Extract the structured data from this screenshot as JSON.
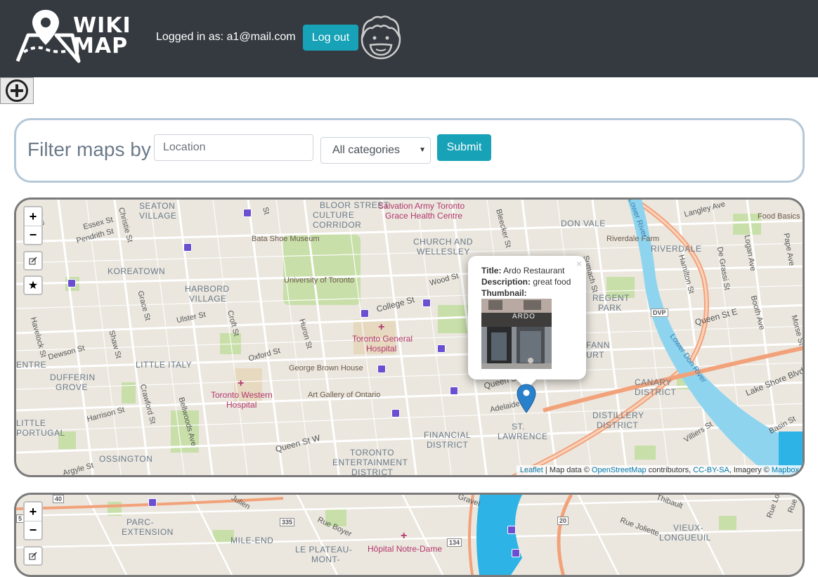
{
  "header": {
    "logo_text": "WIKI\nMAP",
    "login_prefix": "Logged in as: a1@mail.com",
    "logout_label": "Log out"
  },
  "toolbar": {
    "add_icon": "plus-circle-icon"
  },
  "filter": {
    "label": "Filter maps by",
    "location_placeholder": "Location",
    "category_selected": "All categories",
    "submit_label": "Submit"
  },
  "map1": {
    "zoom_in": "+",
    "zoom_out": "−",
    "edit_icon": "edit-icon",
    "star_icon": "★",
    "popup": {
      "title_label": "Title:",
      "title_value": "Ardo Restaurant",
      "description_label": "Description:",
      "description_value": "great food",
      "thumbnail_label": "Thumbnail:",
      "close": "×",
      "storefront_text": "ARDO"
    },
    "attribution": {
      "leaflet": "Leaflet",
      "sep1": " | Map data © ",
      "osm": "OpenStreetMap",
      "sep2": " contributors, ",
      "license": "CC-BY-SA",
      "sep3": ", Imagery © ",
      "mapbox": "Mapbox"
    },
    "labels": [
      {
        "text": "SEATON",
        "cls": "dist"
      },
      {
        "text": "VILLAGE",
        "cls": "dist"
      },
      {
        "text": "BLOOR STREET",
        "cls": "dist"
      },
      {
        "text": "CULTURE",
        "cls": "dist"
      },
      {
        "text": "CORRIDOR",
        "cls": "dist"
      },
      {
        "text": "Salvation Army Toronto",
        "cls": "hosp"
      },
      {
        "text": "Grace Health Centre",
        "cls": "hosp"
      },
      {
        "text": "DON VALE",
        "cls": "dist"
      },
      {
        "text": "Food Basics",
        "cls": "poi"
      },
      {
        "text": "Essex St",
        "cls": "st"
      },
      {
        "text": "Pendrith St",
        "cls": "st"
      },
      {
        "text": "Christie St",
        "cls": "st"
      },
      {
        "text": "Bata Shoe Museum",
        "cls": "poi"
      },
      {
        "text": "CHURCH AND",
        "cls": "dist"
      },
      {
        "text": "WELLESLEY",
        "cls": "dist"
      },
      {
        "text": "Riverdale Farm",
        "cls": "poi"
      },
      {
        "text": "RIVERDALE",
        "cls": "dist"
      },
      {
        "text": "KOREATOWN",
        "cls": "dist"
      },
      {
        "text": "University of Toronto",
        "cls": "poi"
      },
      {
        "text": "HARBORD",
        "cls": "dist"
      },
      {
        "text": "VILLAGE",
        "cls": "dist"
      },
      {
        "text": "Wood St",
        "cls": "st"
      },
      {
        "text": "REGENT",
        "cls": "dist"
      },
      {
        "text": "PARK",
        "cls": "dist"
      },
      {
        "text": "College St",
        "cls": "st"
      },
      {
        "text": "Ulster St",
        "cls": "st"
      },
      {
        "text": "Queen St E",
        "cls": "st"
      },
      {
        "text": "Toronto General",
        "cls": "hosp"
      },
      {
        "text": "Hospital",
        "cls": "hosp"
      },
      {
        "text": "Dewson St",
        "cls": "st"
      },
      {
        "text": "Oxford St",
        "cls": "st"
      },
      {
        "text": "LITTLE ITALY",
        "cls": "dist"
      },
      {
        "text": "George Brown House",
        "cls": "poi"
      },
      {
        "text": "DUFFERIN",
        "cls": "dist"
      },
      {
        "text": "GROVE",
        "cls": "dist"
      },
      {
        "text": "Toronto Western",
        "cls": "hosp"
      },
      {
        "text": "Hospital",
        "cls": "hosp"
      },
      {
        "text": "Art Gallery of Ontario",
        "cls": "poi"
      },
      {
        "text": "Queen St",
        "cls": "st"
      },
      {
        "text": "CANARY",
        "cls": "dist"
      },
      {
        "text": "DISTRICT",
        "cls": "dist"
      },
      {
        "text": "Lake Shore Blvd E",
        "cls": "st"
      },
      {
        "text": "Harrison St",
        "cls": "st"
      },
      {
        "text": "Adelaide",
        "cls": "st"
      },
      {
        "text": "ST.",
        "cls": "dist"
      },
      {
        "text": "LAWRENCE",
        "cls": "dist"
      },
      {
        "text": "DISTILLERY",
        "cls": "dist"
      },
      {
        "text": "DISTRICT",
        "cls": "dist"
      },
      {
        "text": "LITTLE",
        "cls": "dist"
      },
      {
        "text": "PORTUGAL",
        "cls": "dist"
      },
      {
        "text": "FINANCIAL",
        "cls": "dist"
      },
      {
        "text": "DISTRICT",
        "cls": "dist"
      },
      {
        "text": "Villiers St",
        "cls": "st"
      },
      {
        "text": "Basin St",
        "cls": "st"
      },
      {
        "text": "OSSINGTON",
        "cls": "dist"
      },
      {
        "text": "Queen St W",
        "cls": "st"
      },
      {
        "text": "TORONTO",
        "cls": "dist"
      },
      {
        "text": "ENTERTAINMENT",
        "cls": "dist"
      },
      {
        "text": "DISTRICT",
        "cls": "dist"
      },
      {
        "text": "Argyle St",
        "cls": "st"
      },
      {
        "text": "DVP",
        "cls": "st"
      },
      {
        "text": "Logan Ave",
        "cls": "st"
      },
      {
        "text": "Pape Ave",
        "cls": "st"
      },
      {
        "text": "Langley Ave",
        "cls": "st"
      },
      {
        "text": "Hamilton St",
        "cls": "st"
      },
      {
        "text": "De Grassi St",
        "cls": "st"
      },
      {
        "text": "Booth Ave",
        "cls": "st"
      },
      {
        "text": "Morse St",
        "cls": "st"
      },
      {
        "text": "Lower Don River",
        "cls": "st"
      },
      {
        "text": "Grace St",
        "cls": "st"
      },
      {
        "text": "Havelock St",
        "cls": "st"
      },
      {
        "text": "Shaw St",
        "cls": "st"
      },
      {
        "text": "Crawford St",
        "cls": "st"
      },
      {
        "text": "Bellwoods Ave",
        "cls": "st"
      },
      {
        "text": "Croft St",
        "cls": "st"
      },
      {
        "text": "Huron St",
        "cls": "st"
      },
      {
        "text": "Bleecker St",
        "cls": "st"
      },
      {
        "text": "Sumach St",
        "cls": "st"
      },
      {
        "text": "Lower River",
        "cls": "st"
      },
      {
        "text": "Ave",
        "cls": "st"
      },
      {
        "text": "entre",
        "cls": "dist"
      },
      {
        "text": "St",
        "cls": "st"
      },
      {
        "text": "FANN",
        "cls": "dist"
      },
      {
        "text": "URT",
        "cls": "dist"
      }
    ]
  },
  "map2": {
    "zoom_in": "+",
    "zoom_out": "−",
    "edit_icon": "edit-icon",
    "labels": [
      {
        "text": "PARC-",
        "cls": "dist"
      },
      {
        "text": "EXTENSION",
        "cls": "dist"
      },
      {
        "text": "MILE-END",
        "cls": "dist"
      },
      {
        "text": "LE PLATEAU-",
        "cls": "dist"
      },
      {
        "text": "MONT-",
        "cls": "dist"
      },
      {
        "text": "Hôpital Notre-Dame",
        "cls": "hosp"
      },
      {
        "text": "Rue Boyer",
        "cls": "st"
      },
      {
        "text": "VIEUX-",
        "cls": "dist"
      },
      {
        "text": "LONGUEUIL",
        "cls": "dist"
      },
      {
        "text": "Rue Joliette",
        "cls": "st"
      },
      {
        "text": "Julien",
        "cls": "st"
      },
      {
        "text": "Gravel",
        "cls": "st"
      },
      {
        "text": "Thibault",
        "cls": "st"
      },
      {
        "text": "Rue Lo",
        "cls": "st"
      },
      {
        "text": "Rue",
        "cls": "st"
      },
      {
        "text": "335",
        "cls": "st"
      },
      {
        "text": "134",
        "cls": "st"
      },
      {
        "text": "20",
        "cls": "st"
      },
      {
        "text": "40",
        "cls": "st"
      },
      {
        "text": "5",
        "cls": "st"
      }
    ]
  }
}
